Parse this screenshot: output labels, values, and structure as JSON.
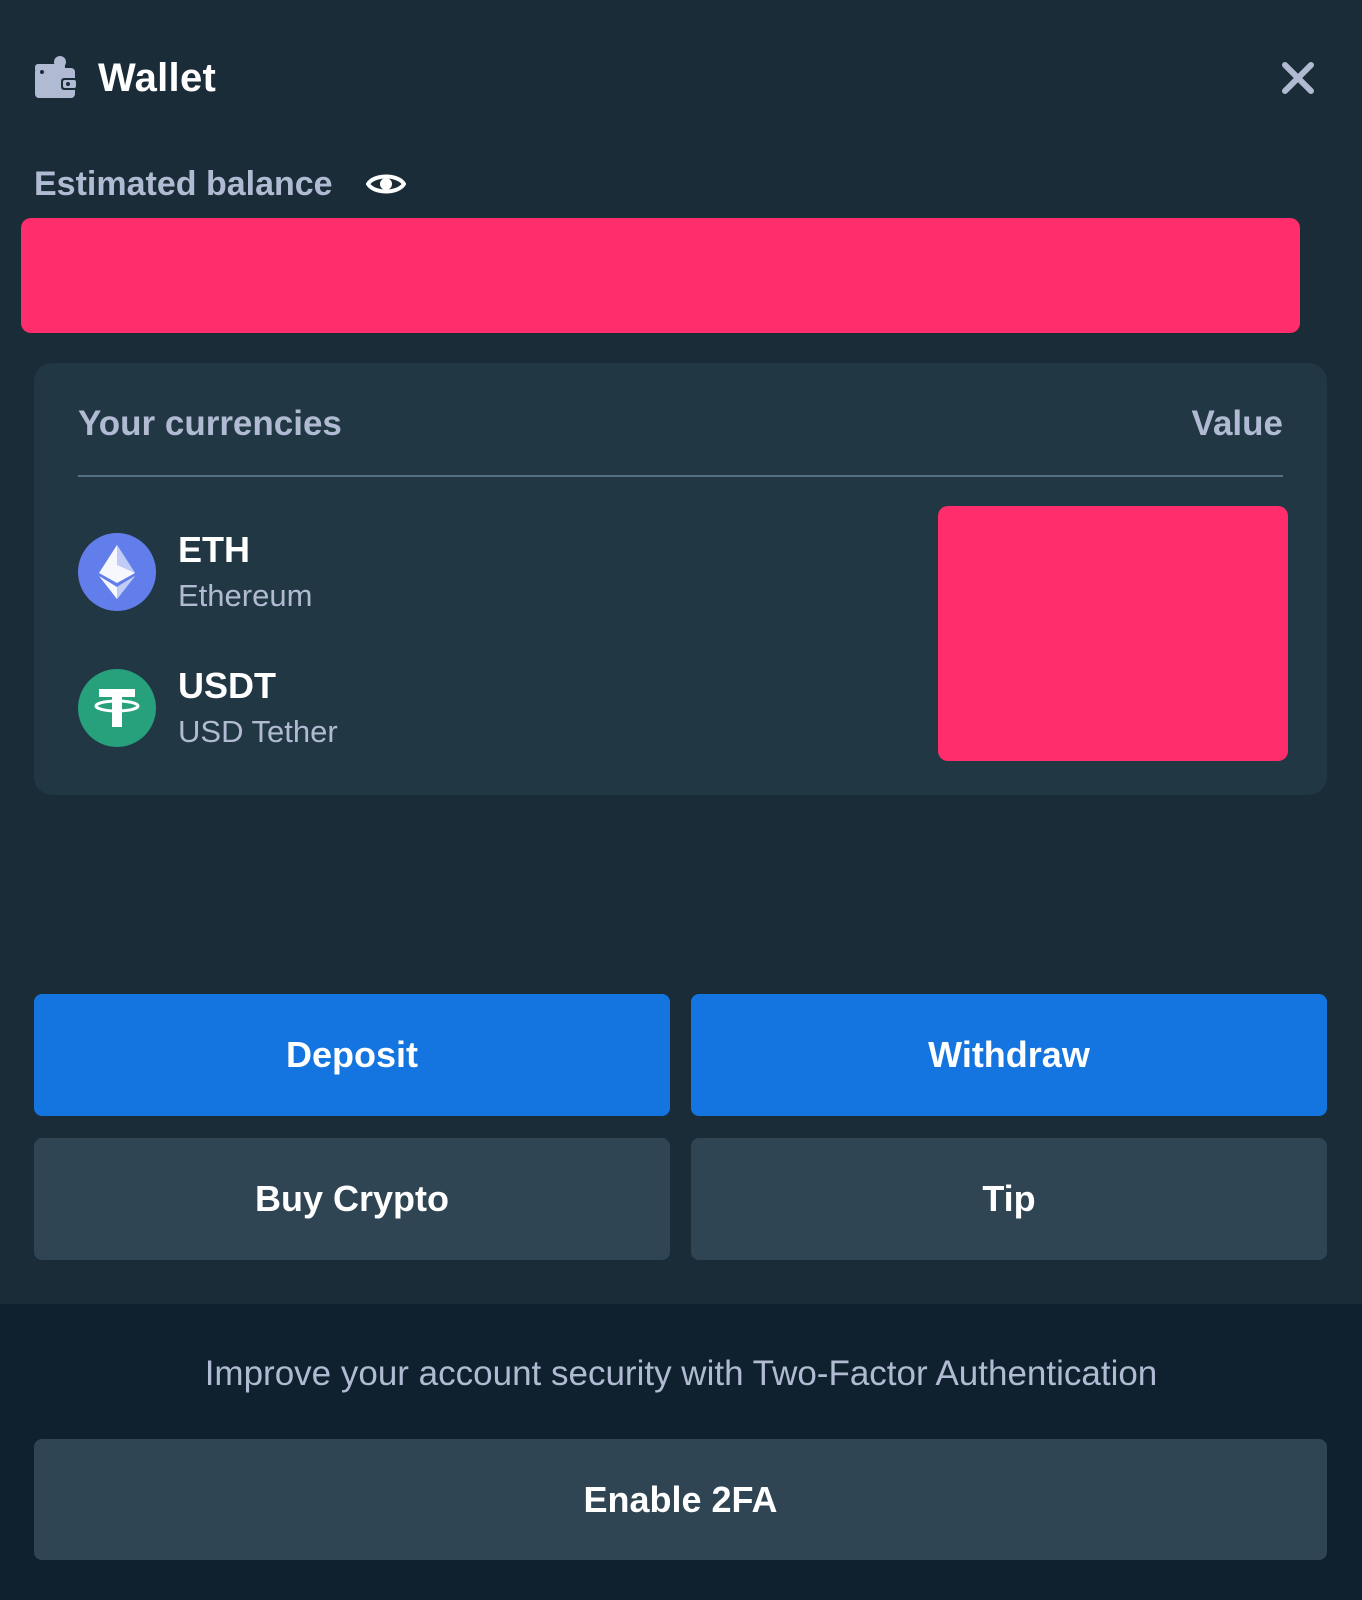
{
  "header": {
    "title": "Wallet",
    "icon": "wallet-icon",
    "close_icon": "close-icon"
  },
  "balance": {
    "label": "Estimated balance",
    "visibility_icon": "eye-icon"
  },
  "currencies": {
    "column_left": "Your currencies",
    "column_right": "Value",
    "items": [
      {
        "symbol": "ETH",
        "name": "Ethereum",
        "icon": "ethereum-icon",
        "color": "#627eea"
      },
      {
        "symbol": "USDT",
        "name": "USD Tether",
        "icon": "tether-icon",
        "color": "#26a17b"
      }
    ]
  },
  "actions": {
    "deposit": "Deposit",
    "withdraw": "Withdraw",
    "buy_crypto": "Buy Crypto",
    "tip": "Tip"
  },
  "security": {
    "message": "Improve your account security with Two-Factor Authentication",
    "enable_label": "Enable 2FA"
  },
  "colors": {
    "background": "#1a2c38",
    "card": "#213743",
    "primary_button": "#1475e1",
    "secondary_button": "#2f4553",
    "footer": "#0f212e",
    "redaction": "#ff2d6b"
  }
}
